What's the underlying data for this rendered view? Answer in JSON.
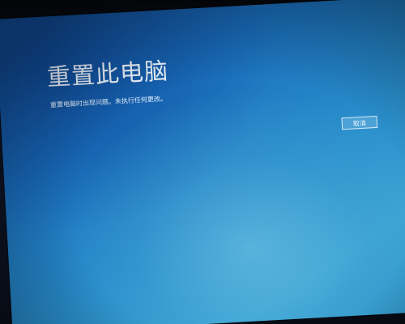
{
  "screen": {
    "title": "重置此电脑",
    "message": "重置电脑时出现问题。未执行任何更改。",
    "cancel_label": "取消"
  },
  "colors": {
    "screen_blue": "#1a6fbd",
    "screen_light": "#3aa3d3",
    "text": "#eef6ff",
    "bezel": "#05070c"
  }
}
